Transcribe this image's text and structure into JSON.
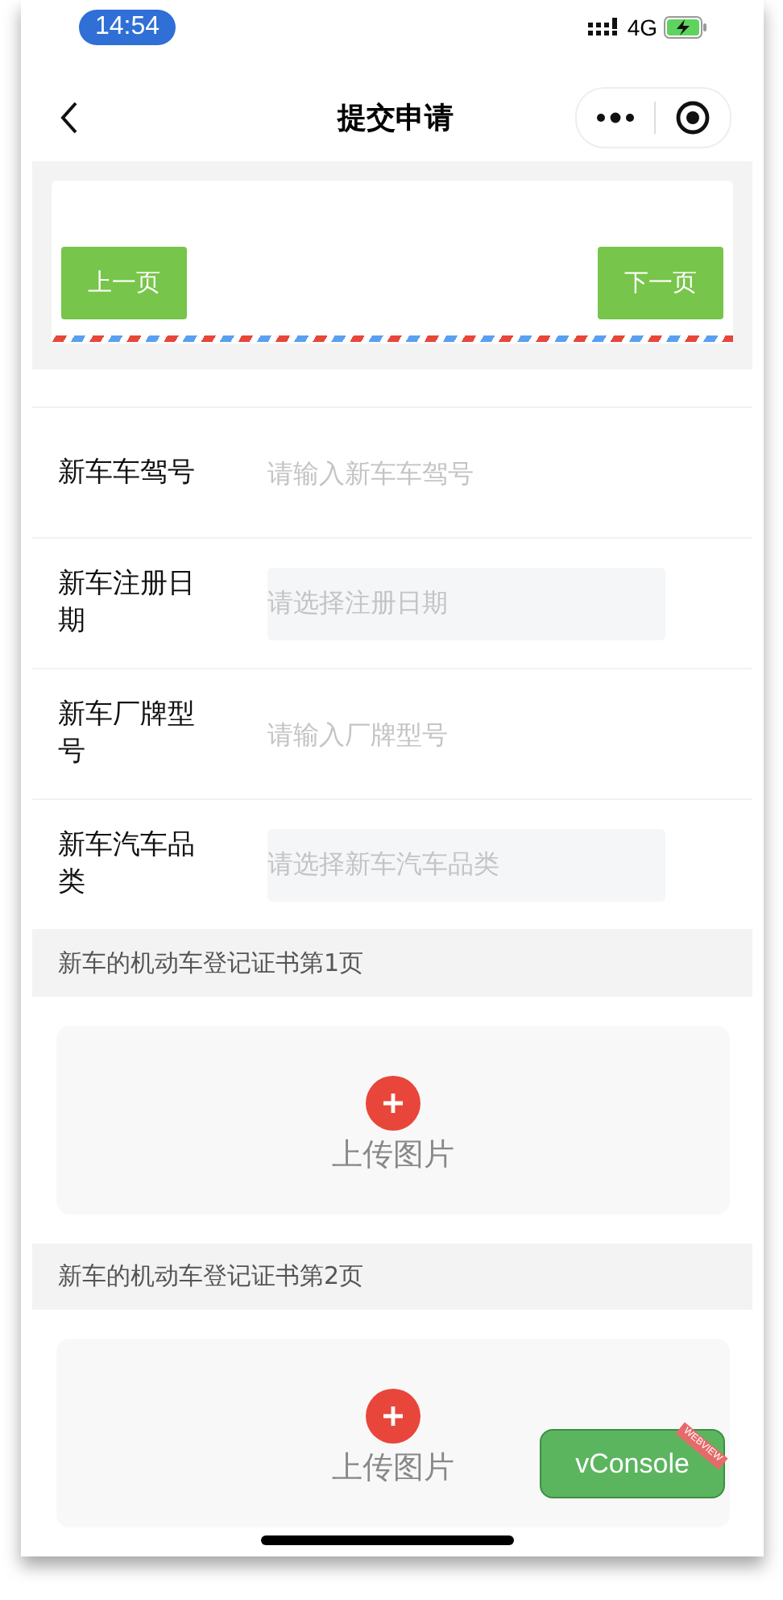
{
  "status_bar": {
    "time": "14:54",
    "network": "4G"
  },
  "nav": {
    "title": "提交申请"
  },
  "pager": {
    "prev": "上一页",
    "next": "下一页"
  },
  "fields": [
    {
      "label": "新车车驾号",
      "placeholder": "请输入新车车驾号",
      "kind": "input"
    },
    {
      "label": "新车注册日期",
      "placeholder": "请选择注册日期",
      "kind": "picker"
    },
    {
      "label": "新车厂牌型号",
      "placeholder": "请输入厂牌型号",
      "kind": "input"
    },
    {
      "label": "新车汽车品类",
      "placeholder": "请选择新车汽车品类",
      "kind": "picker"
    }
  ],
  "uploads": [
    {
      "heading": "新车的机动车登记证书第1页",
      "label": "上传图片"
    },
    {
      "heading": "新车的机动车登记证书第2页",
      "label": "上传图片"
    }
  ],
  "vconsole": {
    "label": "vConsole",
    "ribbon": "WEBVIEW"
  }
}
